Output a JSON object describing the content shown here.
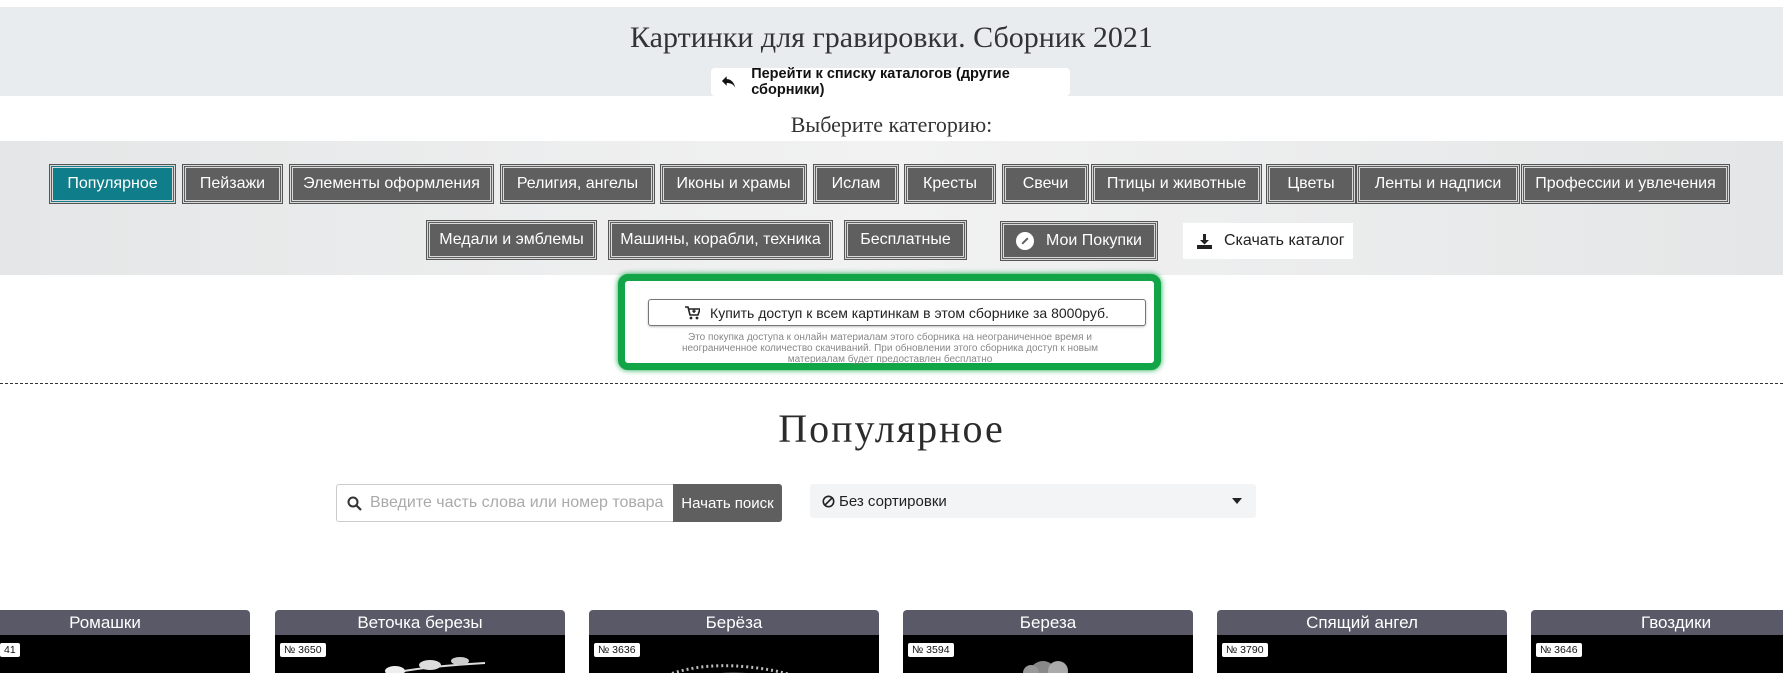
{
  "header": {
    "title": "Картинки для гравировки. Сборник 2021",
    "back_link": "Перейти к списку каталогов (другие сборники)"
  },
  "choose_label": "Выберите категорию:",
  "categories": [
    "Популярное",
    "Пейзажи",
    "Элементы оформления",
    "Религия, ангелы",
    "Иконы и храмы",
    "Ислам",
    "Кресты",
    "Свечи",
    "Птицы и животные",
    "Цветы",
    "Ленты и надписи",
    "Профессии и увлечения",
    "Медали и эмблемы",
    "Машины, корабли, техника",
    "Бесплатные"
  ],
  "active_category": "Популярное",
  "my_purchases": "Мои Покупки",
  "download_catalog": "Скачать каталог",
  "promo": {
    "buy_button": "Купить доступ к всем картинкам в этом сборнике за 8000руб.",
    "note": "Это покупка доступа к онлайн материалам этого сборника на неограниченное время и неограниченное количество скачиваний. При обновлении этого сборника доступ к новым материалам будет предоставлен бесплатно"
  },
  "section_title": "Популярное",
  "search": {
    "placeholder": "Введите часть слова или номер товара",
    "button": "Начать поиск"
  },
  "sort": {
    "selected": "Без сортировки"
  },
  "products": [
    {
      "title": "Ромашки",
      "number": "41"
    },
    {
      "title": "Веточка березы",
      "number": "№ 3650"
    },
    {
      "title": "Берёза",
      "number": "№ 3636"
    },
    {
      "title": "Береза",
      "number": "№ 3594"
    },
    {
      "title": "Спящий ангел",
      "number": "№ 3790"
    },
    {
      "title": "Гвоздики",
      "number": "№ 3646"
    }
  ],
  "colors": {
    "active_category": "#107e8a",
    "category": "#5f5f5f",
    "promo_border": "#11a548",
    "card_header": "#5a5968"
  }
}
